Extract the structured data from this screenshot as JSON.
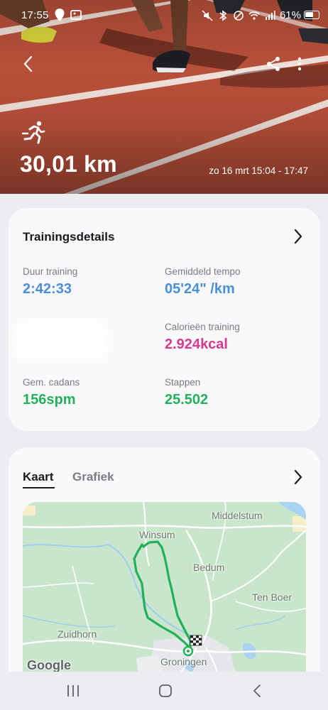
{
  "status_bar": {
    "time": "17:55",
    "battery": "61%",
    "battery_level": 0.61
  },
  "hero": {
    "activity_icon": "running-person-icon",
    "distance": "30,01 km",
    "datetime": "zo 16 mrt 15:04 - 17:47",
    "background_color": "#b14a31"
  },
  "toolbar": {
    "back_icon": "chevron-left-icon",
    "share_icon": "share-icon",
    "more_icon": "more-vertical-icon"
  },
  "details": {
    "title": "Trainingsdetails",
    "duration_label": "Duur training",
    "duration_value": "2:42:33",
    "pace_label": "Gemiddeld tempo",
    "pace_value": "05'24\" /km",
    "calories_label": "Calorieën training",
    "calories_value": "2.924",
    "calories_unit": "kcal",
    "cadence_label": "Gem. cadans",
    "cadence_value": "156",
    "cadence_unit": "spm",
    "steps_label": "Stappen",
    "steps_value": "25.502",
    "colors": {
      "blue": "#4a8fd8",
      "pink": "#d63a91",
      "green": "#22b15a"
    }
  },
  "map_card": {
    "tabs": [
      {
        "label": "Kaart",
        "active": true
      },
      {
        "label": "Grafiek",
        "active": false
      }
    ],
    "places": [
      "Middelstum",
      "Winsum",
      "Bedum",
      "Ten Boer",
      "Zuidhorn",
      "Groningen"
    ],
    "attribution": "Google",
    "route_color": "#22b15a"
  },
  "nav_bar": {
    "recents_icon": "recent-apps-icon",
    "home_icon": "home-icon",
    "back_icon": "back-icon"
  }
}
